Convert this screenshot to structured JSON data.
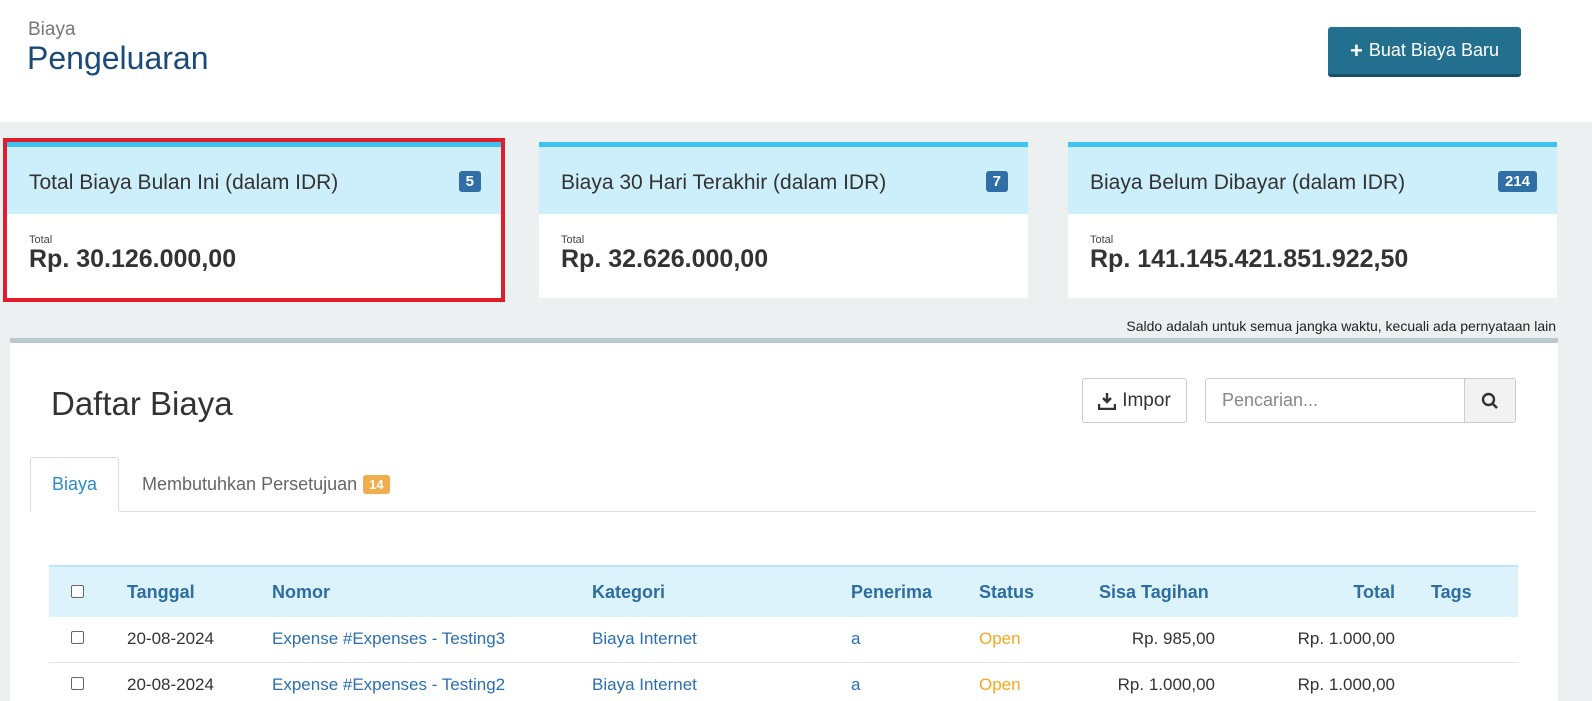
{
  "header": {
    "breadcrumb": "Biaya",
    "title": "Pengeluaran",
    "new_button": "Buat Biaya Baru"
  },
  "cards": [
    {
      "title": "Total Biaya Bulan Ini (dalam IDR)",
      "badge": "5",
      "label": "Total",
      "value": "Rp. 30.126.000,00"
    },
    {
      "title": "Biaya 30 Hari Terakhir (dalam IDR)",
      "badge": "7",
      "label": "Total",
      "value": "Rp. 32.626.000,00"
    },
    {
      "title": "Biaya Belum Dibayar (dalam IDR)",
      "badge": "214",
      "label": "Total",
      "value": "Rp. 141.145.421.851.922,50"
    }
  ],
  "note": "Saldo adalah untuk semua jangka waktu, kecuali ada pernyataan lain",
  "list": {
    "title": "Daftar Biaya",
    "import_label": "Impor",
    "search_placeholder": "Pencarian..."
  },
  "tabs": [
    {
      "label": "Biaya"
    },
    {
      "label": "Membutuhkan Persetujuan",
      "count": "14"
    }
  ],
  "table": {
    "columns": [
      "Tanggal",
      "Nomor",
      "Kategori",
      "Penerima",
      "Status",
      "Sisa Tagihan",
      "Total",
      "Tags"
    ],
    "rows": [
      {
        "date": "20-08-2024",
        "number": "Expense #Expenses - Testing3",
        "category": "Biaya Internet",
        "recipient": "a",
        "status": "Open",
        "balance": "Rp. 985,00",
        "total": "Rp. 1.000,00",
        "tags": ""
      },
      {
        "date": "20-08-2024",
        "number": "Expense #Expenses - Testing2",
        "category": "Biaya Internet",
        "recipient": "a",
        "status": "Open",
        "balance": "Rp. 1.000,00",
        "total": "Rp. 1.000,00",
        "tags": ""
      }
    ]
  },
  "colors": {
    "title": "#1b4a7a",
    "primary_button": "#236f8e",
    "card_header": "#cdeefb",
    "card_accent": "#3ec2f0",
    "badge": "#2f6fa6",
    "highlight_outline": "#e11d2b",
    "link": "#2a6fb0",
    "status_open": "#f2a91b",
    "tab_count": "#f0ad4e"
  }
}
